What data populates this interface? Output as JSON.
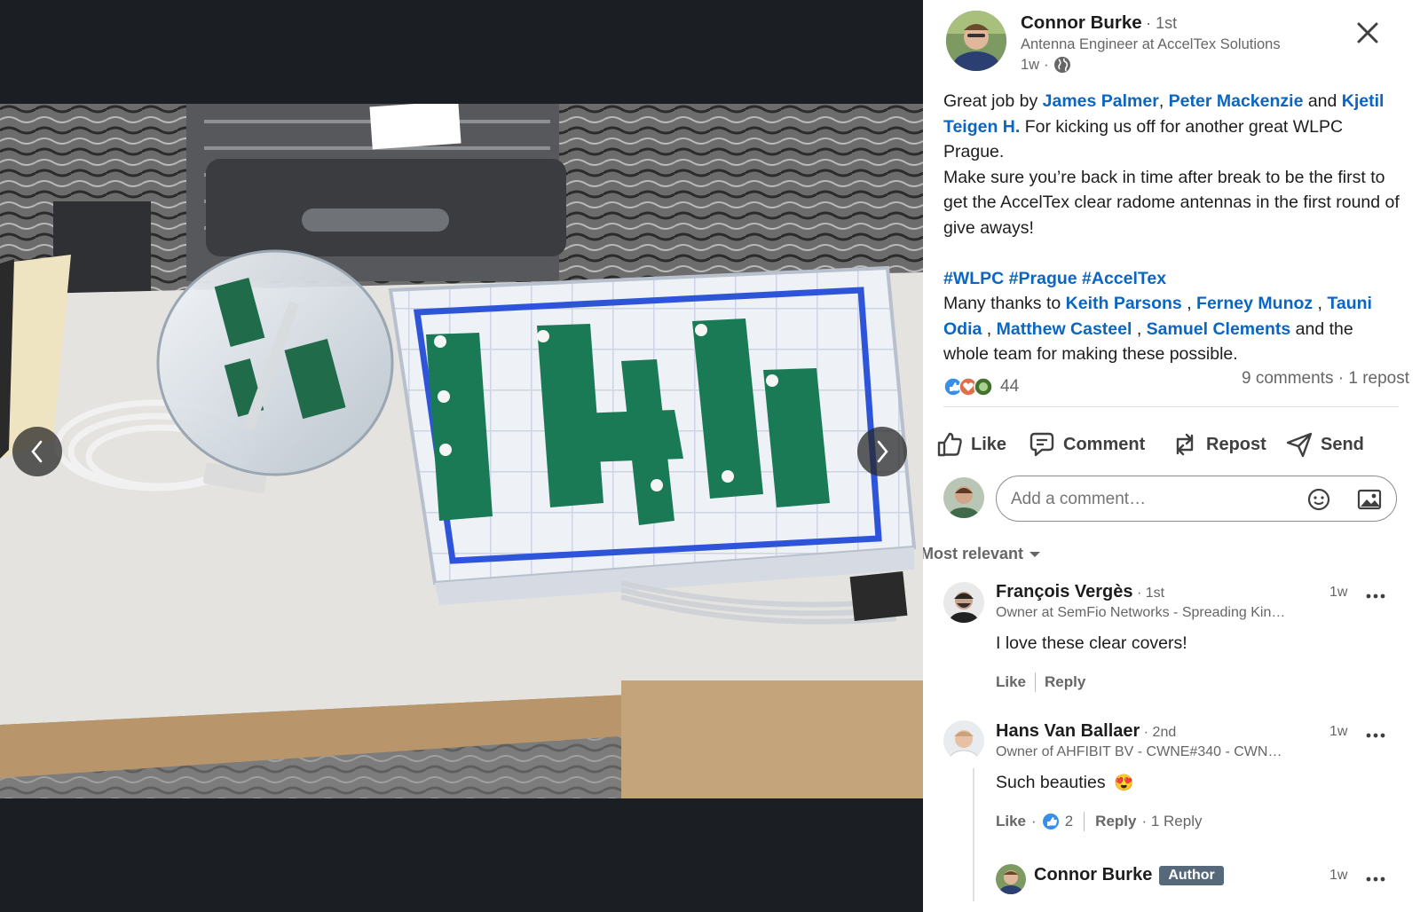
{
  "post": {
    "author": {
      "name": "Connor Burke",
      "degree": "1st",
      "headline": "Antenna Engineer at AccelTex Solutions",
      "time": "1w",
      "visibility_icon": "globe-icon"
    },
    "text": {
      "p1_start": "Great job by ",
      "mention_james": "James Palmer",
      "comma1": ", ",
      "mention_peter": "Peter Mackenzie",
      "and1": " and ",
      "mention_kjetil": "Kjetil Teigen H.",
      "p1_end": " For kicking us off for another great WLPC Prague.",
      "p2": "Make sure you’re back in time after break to be the first to get the AccelTex clear radome antennas in the first round of give aways!",
      "hashtags": "#WLPC #Prague #AccelTex",
      "p3_start": "Many thanks to ",
      "mention_keith": "Keith Parsons",
      "sep1": " , ",
      "mention_ferney": "Ferney Munoz",
      "sep2": " , ",
      "mention_tauni": "Tauni Odia",
      "sep3": " , ",
      "mention_matthew": "Matthew Casteel",
      "sep4": " , ",
      "mention_samuel": "Samuel Clements",
      "p3_end": " and the whole team for making these possible."
    },
    "reactions": {
      "count": "44",
      "comments": "9 comments",
      "dot": " · ",
      "reposts": "1 repost"
    },
    "actions": {
      "like": "Like",
      "comment": "Comment",
      "repost": "Repost",
      "send": "Send"
    }
  },
  "composer": {
    "placeholder": "Add a comment…"
  },
  "sort": {
    "label": "Most relevant"
  },
  "comments": [
    {
      "name": "François Vergès",
      "degree": "· 1st",
      "headline": "Owner at SemFio Networks - Spreading Kin…",
      "time": "1w",
      "text": "I love these clear covers!",
      "like": "Like",
      "reply": "Reply"
    },
    {
      "name": "Hans Van Ballaer",
      "degree": "· 2nd",
      "headline": "Owner of AHFIBIT BV - CWNE#340 - CWN…",
      "time": "1w",
      "text": "Such beauties",
      "emoji": "😍",
      "like": "Like",
      "like_sep": " · ",
      "like_count": "2",
      "reply": "Reply",
      "reply_count": " · 1 Reply"
    }
  ],
  "reply_preview": {
    "name": "Connor Burke",
    "badge": "Author",
    "time": "1w"
  },
  "colors": {
    "link": "#0a66c2",
    "author_badge": "#56687a",
    "media_bg": "#1b1f23"
  }
}
